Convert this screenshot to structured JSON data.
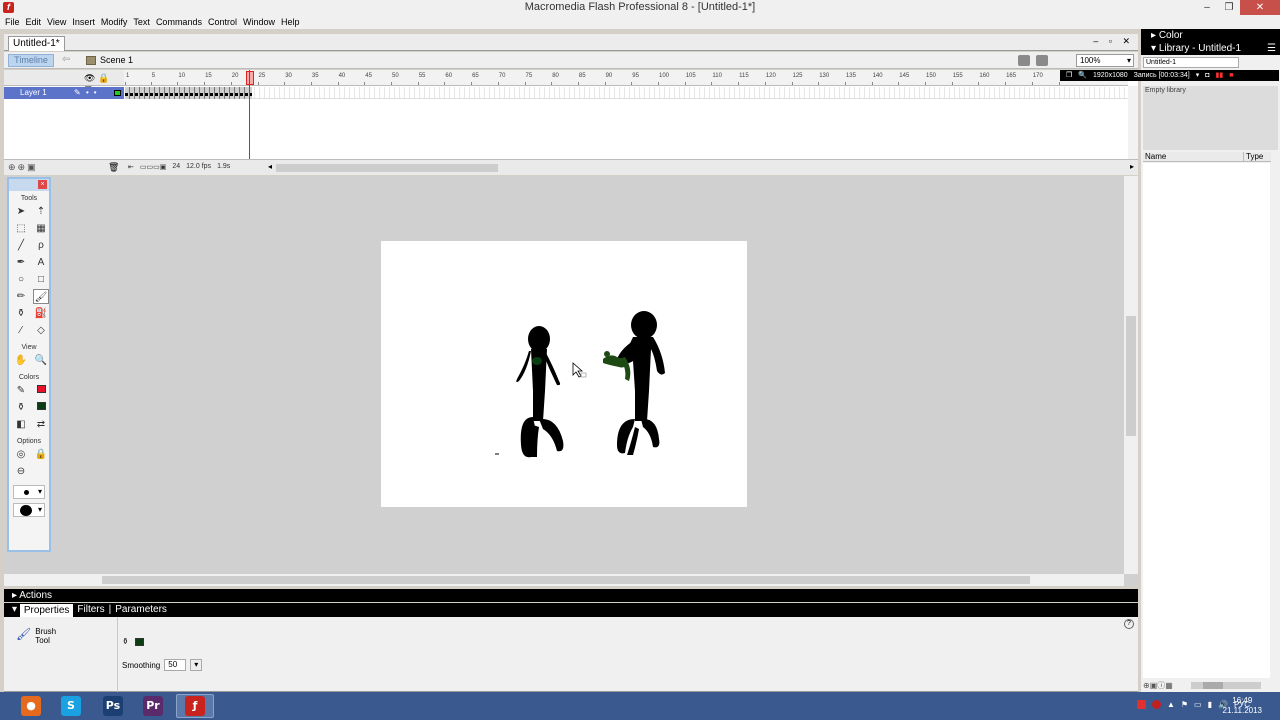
{
  "window": {
    "title": "Macromedia Flash Professional 8 - [Untitled-1*]",
    "controls": [
      "–",
      "❐",
      "✕"
    ]
  },
  "menu": [
    "File",
    "Edit",
    "View",
    "Insert",
    "Modify",
    "Text",
    "Commands",
    "Control",
    "Window",
    "Help"
  ],
  "document": {
    "tab": "Untitled-1*",
    "controls": "– ▫ ✕"
  },
  "editbar": {
    "timeline_button": "Timeline",
    "scene": "Scene 1",
    "zoom": "100%"
  },
  "timeline": {
    "ruler_ticks": [
      "1",
      "5",
      "10",
      "15",
      "20",
      "25",
      "30",
      "35",
      "40",
      "45",
      "50",
      "55",
      "60",
      "65",
      "70",
      "75",
      "80",
      "85",
      "90",
      "95",
      "100",
      "105",
      "110",
      "115",
      "120",
      "125",
      "130",
      "135",
      "140",
      "145",
      "150",
      "155",
      "160",
      "165",
      "170",
      "1"
    ],
    "layer": "Layer 1",
    "current_frame": "24",
    "fps": "12.0 fps",
    "elapsed": "1.9s"
  },
  "tools": {
    "title": "Tools",
    "sections": {
      "view": "View",
      "colors": "Colors",
      "options": "Options"
    }
  },
  "panels": {
    "actions": "Actions",
    "tabs": [
      "Properties",
      "Filters",
      "Parameters"
    ],
    "tool_name_1": "Brush",
    "tool_name_2": "Tool",
    "smoothing_label": "Smoothing",
    "smoothing_value": "50"
  },
  "right_panel": {
    "color": "Color",
    "library": "Library - Untitled-1",
    "library_select": "Untitled-1",
    "empty": "Empty library",
    "col_name": "Name",
    "col_type": "Type"
  },
  "recording": {
    "resolution": "1920x1080",
    "label": "Запись [00:03:34]"
  },
  "taskbar": {
    "apps": [
      {
        "name": "firefox",
        "glyph": "●",
        "color": "#e66a1d"
      },
      {
        "name": "skype",
        "glyph": "S",
        "color": "#1aa1e1"
      },
      {
        "name": "photoshop",
        "glyph": "Ps",
        "color": "#1b3e73"
      },
      {
        "name": "premiere",
        "glyph": "Pr",
        "color": "#5b2a6b"
      },
      {
        "name": "flash",
        "glyph": "ƒ",
        "color": "#c9231e"
      }
    ],
    "lang": "РУС",
    "time": "16:49",
    "date": "21.11.2013"
  },
  "colors": {
    "stroke": "#e8132b",
    "fill": "#0a3d12",
    "figure": "#000000",
    "accent_green": "#1e4a14"
  }
}
